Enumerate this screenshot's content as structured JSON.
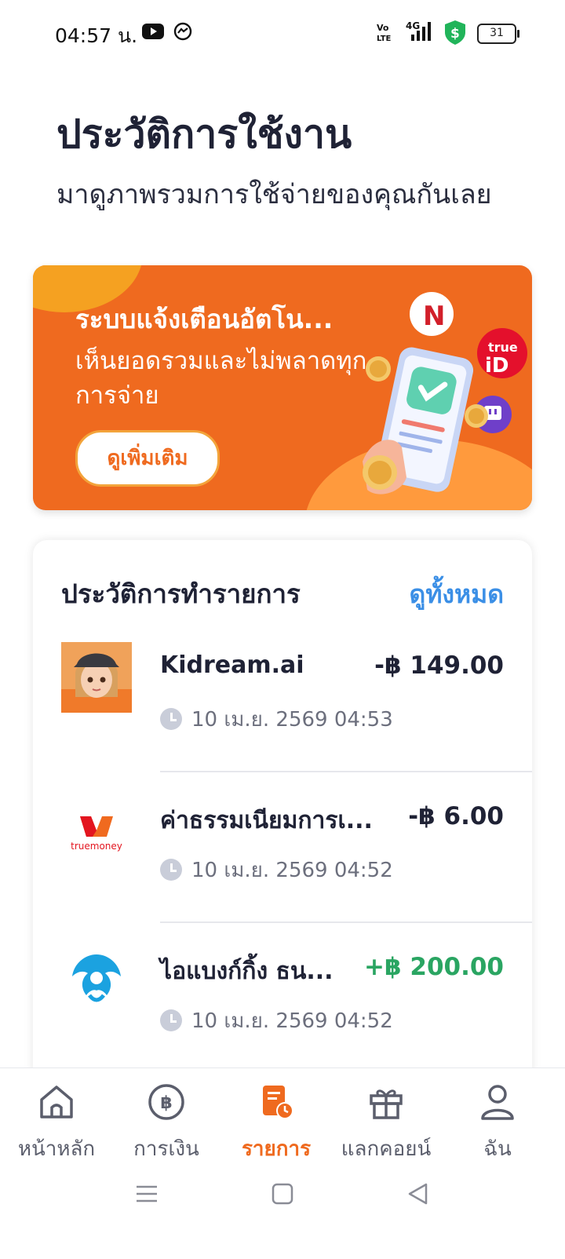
{
  "status_bar": {
    "time": "04:57 น.",
    "network": "4G",
    "battery": "31"
  },
  "header": {
    "title": "ประวัติการใช้งาน",
    "subtitle": "มาดูภาพรวมการใช้จ่ายของคุณกันเลย"
  },
  "banner": {
    "title": "ระบบแจ้งเตือนอัตโน...",
    "description": "เห็นยอดรวมและไม่พลาดทุกการจ่าย",
    "button_label": "ดูเพิ่มเติม",
    "brand_labels": [
      "N",
      "true iD"
    ]
  },
  "transactions": {
    "title": "ประวัติการทำรายการ",
    "see_all": "ดูทั้งหมด",
    "items": [
      {
        "name": "Kidream.ai",
        "amount": "-฿ 149.00",
        "time": "10 เม.ย. 2569 04:53",
        "type": "debit"
      },
      {
        "name": "ค่าธรรมเนียมการเ...",
        "amount": "-฿ 6.00",
        "time": "10 เม.ย. 2569 04:52",
        "type": "debit",
        "logo_text": "truemoney"
      },
      {
        "name": "ไอแบงก์กิ้ง  ธน...",
        "amount": "+฿ 200.00",
        "time": "10 เม.ย. 2569 04:52",
        "type": "credit"
      }
    ]
  },
  "bottom_nav": {
    "items": [
      {
        "label": "หน้าหลัก",
        "icon": "home-icon"
      },
      {
        "label": "การเงิน",
        "icon": "baht-icon"
      },
      {
        "label": "รายการ",
        "icon": "transaction-list-icon",
        "active": true
      },
      {
        "label": "แลกคอยน์",
        "icon": "gift-icon"
      },
      {
        "label": "ฉัน",
        "icon": "profile-icon"
      }
    ]
  },
  "colors": {
    "accent": "#ef6a1f",
    "link": "#3b8fe6",
    "positive": "#2aa562",
    "text_dark": "#1f2235"
  }
}
